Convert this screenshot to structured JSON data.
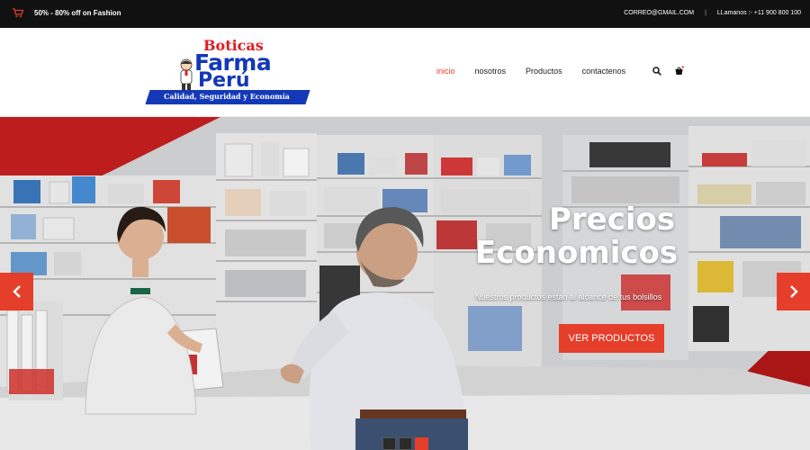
{
  "topbar": {
    "promo": "50% - 80% off on Fashion",
    "email": "CORREO@GMAIL.COM",
    "separator": "|",
    "phone": "LLamanos :- +11 900 800 100"
  },
  "logo": {
    "line1": "Boticas",
    "line2": "Farma",
    "line3": "Perú",
    "tagline": "Calidad, Seguridad y Economía"
  },
  "nav": {
    "items": [
      {
        "label": "inicio",
        "active": true
      },
      {
        "label": "nosotros",
        "active": false
      },
      {
        "label": "Productos",
        "active": false
      },
      {
        "label": "contactenos",
        "active": false
      }
    ],
    "icons": [
      "search-icon",
      "cart-icon"
    ]
  },
  "hero": {
    "title_line1": "Precios",
    "title_line2": "Economicos",
    "subtitle": "Nuestros productos estan al alcance de tus bolsillos",
    "cta": "VER PRODUCTOS",
    "slides": 3,
    "active_slide": 3
  },
  "colors": {
    "accent": "#e53e2a",
    "topbar": "#111111",
    "brand_red": "#e11b22",
    "brand_blue": "#1338b8"
  }
}
